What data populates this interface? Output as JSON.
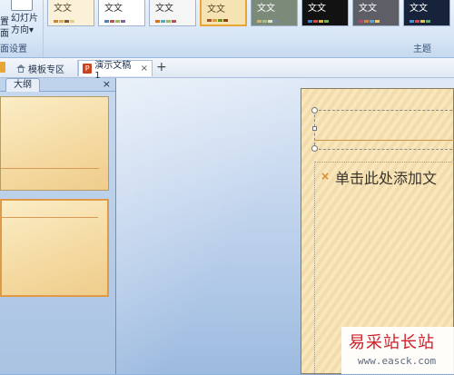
{
  "ribbon": {
    "left_stub_top": "置",
    "left_stub_bottom": "面",
    "slide_direction_line1": "幻灯片",
    "slide_direction_line2": "方向",
    "left_group_label": "面设置",
    "right_group_label": "主题",
    "themes": [
      {
        "text": "文文",
        "bg": "#fbf1d9",
        "fg": "#5a4a2a",
        "swatch": [
          "#c8842f",
          "#e3a84a",
          "#7b5a2e",
          "#e9c987"
        ]
      },
      {
        "text": "文文",
        "bg": "#ffffff",
        "fg": "#333333",
        "swatch": [
          "#4f81bd",
          "#c0504d",
          "#9bbb59",
          "#8064a2"
        ]
      },
      {
        "text": "文文",
        "bg": "#f5f5f5",
        "fg": "#333333",
        "swatch": [
          "#e46c0a",
          "#4bacc6",
          "#9bbb59",
          "#c0504d"
        ]
      },
      {
        "text": "文文",
        "bg": "#f6e3b4",
        "fg": "#5a4a2a",
        "swatch": [
          "#a0522d",
          "#d79b3c",
          "#6b8e23",
          "#8b4513"
        ]
      },
      {
        "text": "文文",
        "bg": "#7c8a7a",
        "fg": "#ffffff",
        "swatch": [
          "#d4b46a",
          "#a9c27b",
          "#e8e0c8",
          "#6e8fb5"
        ]
      },
      {
        "text": "文文",
        "bg": "#121212",
        "fg": "#ffffff",
        "swatch": [
          "#3c7fd8",
          "#d84a3c",
          "#e5b43a",
          "#6fb84a"
        ]
      },
      {
        "text": "文文",
        "bg": "#5e5e66",
        "fg": "#ffffff",
        "swatch": [
          "#c04070",
          "#e08030",
          "#6aa0d0",
          "#f0d060"
        ]
      },
      {
        "text": "文文",
        "bg": "#16233a",
        "fg": "#ffffff",
        "swatch": [
          "#4a90d9",
          "#d94a4a",
          "#e8c24a",
          "#5ab35a"
        ]
      }
    ]
  },
  "tabs": {
    "home_label": "模板专区",
    "doc_label": "演示文稿1",
    "doc_icon": "P",
    "close_glyph": "×",
    "new_tab_glyph": "+"
  },
  "outline_pane": {
    "tab_label": "大纲",
    "close_glyph": "×"
  },
  "slide": {
    "body_placeholder": "单击此处添加文",
    "bullet_glyph": "×"
  },
  "watermark": {
    "title": "易采站长站",
    "url": "www.easck.com"
  }
}
